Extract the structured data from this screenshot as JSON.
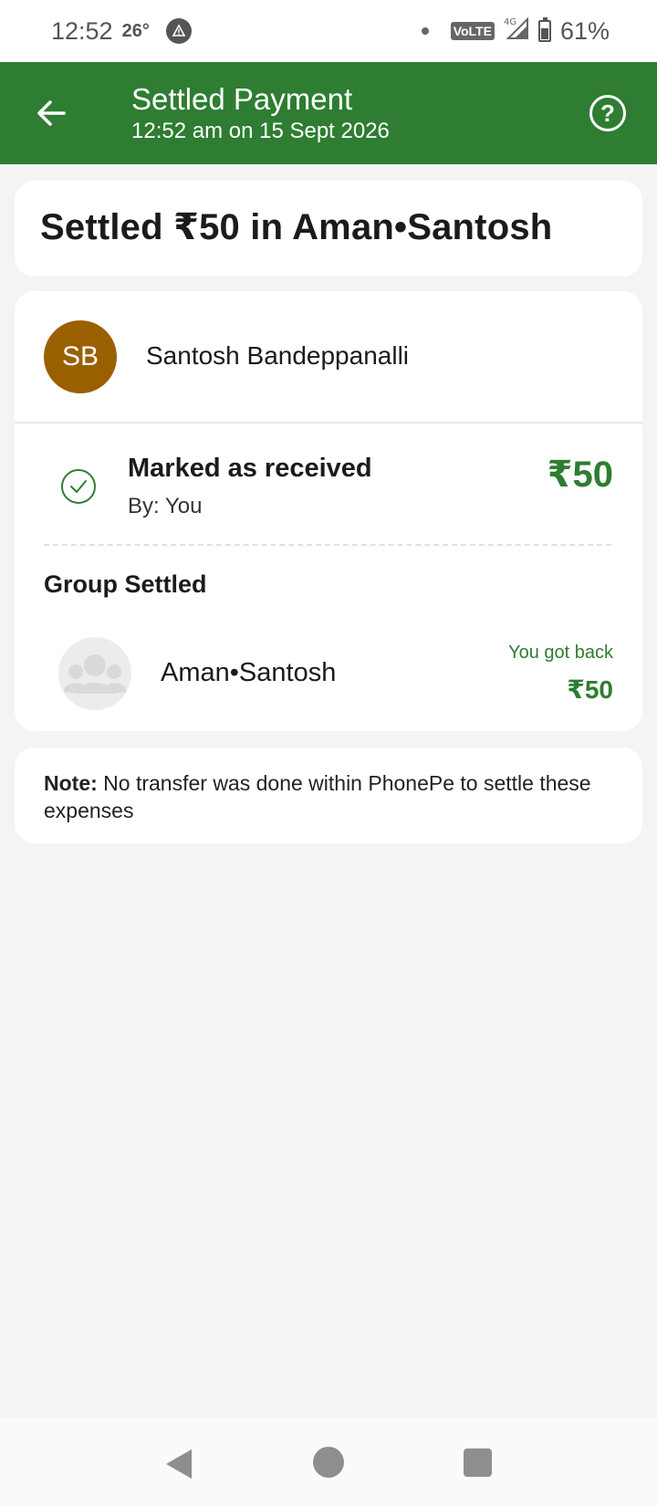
{
  "status_bar": {
    "time": "12:52",
    "temperature": "26°",
    "network": "4G",
    "volte": "VoLTE",
    "battery": "61%",
    "icons": [
      "alert-icon",
      "notification-dot-icon",
      "signal-icon",
      "battery-icon"
    ]
  },
  "header": {
    "title": "Settled Payment",
    "subtitle": "12:52 am on 15 Sept 2026",
    "back_icon": "arrow-left-icon",
    "help_icon": "help-circle-icon",
    "color": "#2e7d32"
  },
  "summary": {
    "title": "Settled ₹50 in Aman•Santosh"
  },
  "person": {
    "initials": "SB",
    "name": "Santosh Bandeppanalli",
    "avatar_color": "#9a6000"
  },
  "transaction": {
    "status": "Marked as received",
    "by": "By: You",
    "amount": "₹50",
    "status_icon": "check-circle-icon"
  },
  "group": {
    "heading": "Group Settled",
    "name": "Aman•Santosh",
    "got_back_label": "You got back",
    "amount": "₹50",
    "icon": "group-avatar-icon"
  },
  "note": {
    "label": "Note:",
    "text": " No transfer was done within PhonePe to settle these expenses"
  },
  "nav": {
    "icons": [
      "nav-back-icon",
      "nav-home-icon",
      "nav-recents-icon"
    ]
  }
}
